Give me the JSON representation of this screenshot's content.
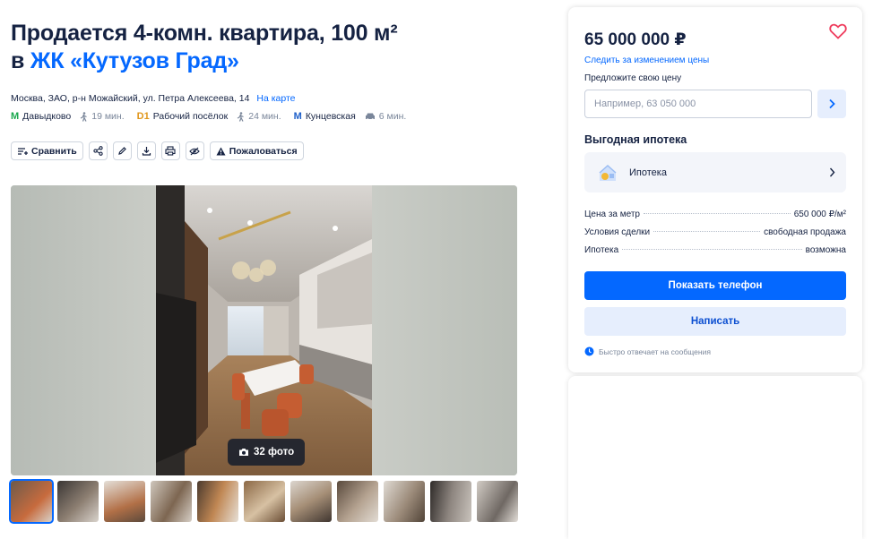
{
  "listing": {
    "title_line1": "Продается 4-комн. квартира, 100 м²",
    "title_prefix": "в",
    "complex_link": "ЖК «Кутузов Град»",
    "address": "Москва, ЗАО, р-н Можайский, ул. Петра Алексеева, 14",
    "map_link": "На карте",
    "metro": [
      {
        "name": "Давыдково",
        "icon": "metro-m-icon",
        "color": "#1aa84d",
        "time": "19 мин.",
        "mode": "walk-icon"
      },
      {
        "name": "Рабочий посёлок",
        "icon": "d1-icon",
        "color": "#e0961b",
        "time": "24 мин.",
        "mode": "walk-icon"
      },
      {
        "name": "Кунцевская",
        "icon": "metro-m-icon",
        "color": "#1d5fc9",
        "time": "6 мин.",
        "mode": "car-icon"
      }
    ]
  },
  "toolbar": {
    "compare_label": "Сравнить",
    "report_label": "Пожаловаться"
  },
  "gallery": {
    "photo_count_label": "32 фото",
    "thumbnail_count": 11,
    "active_thumbnail": 1
  },
  "sidebar": {
    "price": "65 000 000 ₽",
    "watch_price": "Следить за изменением цены",
    "offer_label": "Предложите свою цену",
    "offer_placeholder": "Например, 63 050 000",
    "mortgage_title": "Выгодная ипотека",
    "mortgage_item": "Ипотека",
    "info": [
      {
        "key": "Цена за метр",
        "value": "650 000 ₽/м²"
      },
      {
        "key": "Условия сделки",
        "value": "свободная продажа"
      },
      {
        "key": "Ипотека",
        "value": "возможна"
      }
    ],
    "show_phone": "Показать телефон",
    "write": "Написать",
    "fast_reply": "Быстро отвечает на сообщения"
  },
  "colors": {
    "accent": "#0468ff",
    "text": "#152242",
    "light_button": "#e6eefd",
    "heart": "#ef3b5c"
  }
}
